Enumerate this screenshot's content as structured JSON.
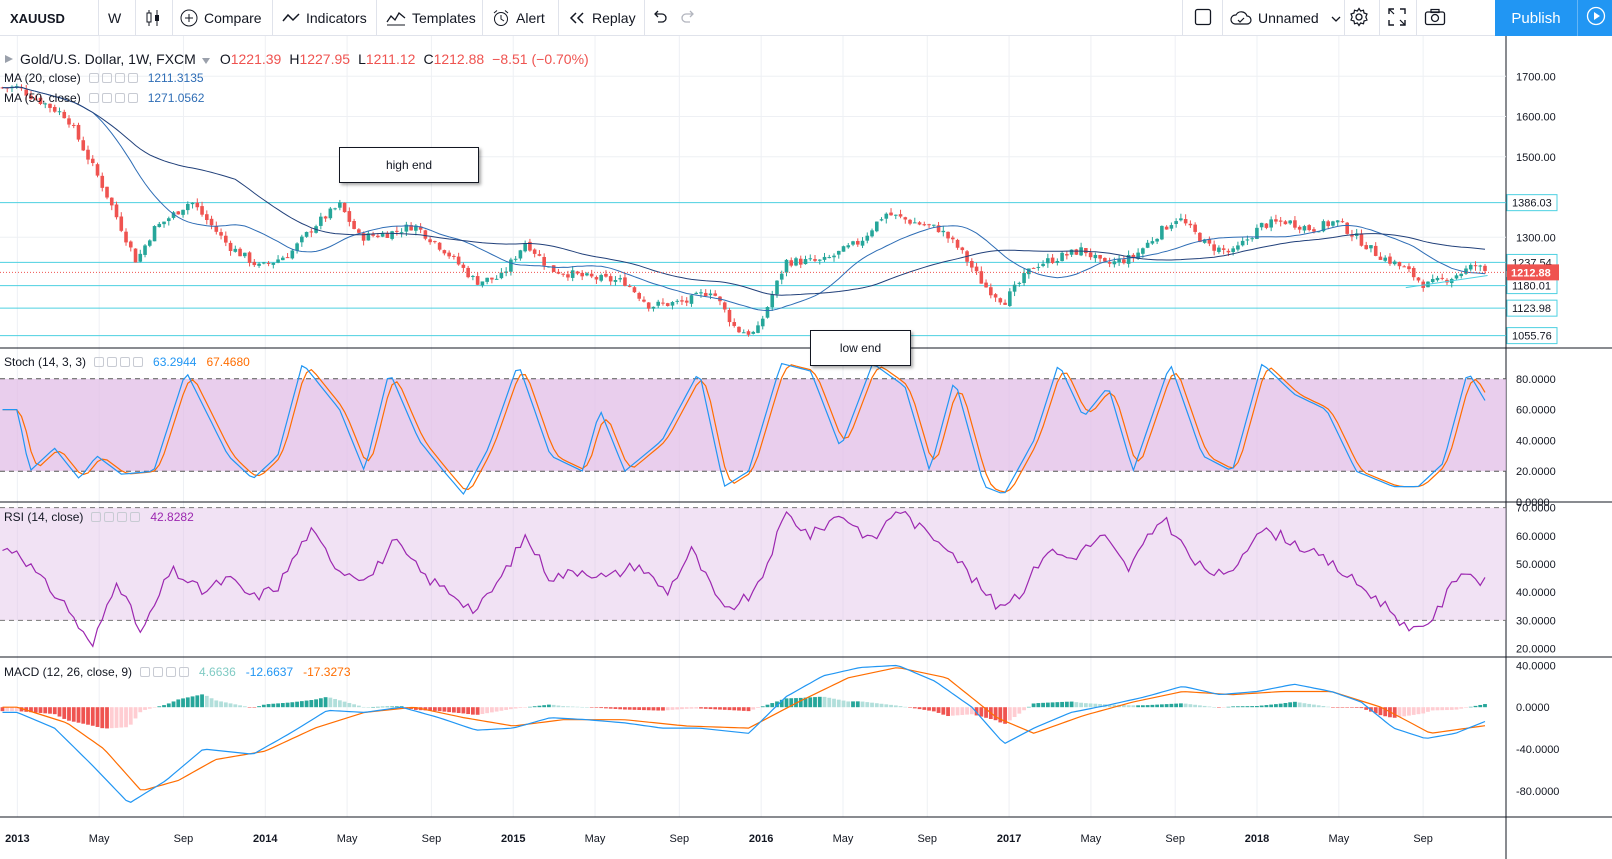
{
  "toolbar": {
    "symbol": "XAUUSD",
    "interval": "W",
    "compare": "Compare",
    "indicators": "Indicators",
    "templates": "Templates",
    "alert": "Alert",
    "replay": "Replay",
    "layout_name": "Unnamed",
    "publish": "Publish"
  },
  "header": {
    "title": "Gold/U.S. Dollar, 1W, FXCM",
    "open_label": "O",
    "open": "1221.39",
    "high_label": "H",
    "high": "1227.95",
    "low_label": "L",
    "low": "1211.12",
    "close_label": "C",
    "close": "1212.88",
    "change": "−8.51 (−0.70%)"
  },
  "indicators": {
    "ma20": {
      "label": "MA (20, close)",
      "value": "1211.3135",
      "color": "#2e6db5"
    },
    "ma50": {
      "label": "MA (50, close)",
      "value": "1271.0562",
      "color": "#21407a"
    },
    "stoch": {
      "label": "Stoch (14, 3, 3)",
      "k": "63.2944",
      "d": "67.4680",
      "k_color": "#2196f3",
      "d_color": "#ff6d00"
    },
    "rsi": {
      "label": "RSI (14, close)",
      "value": "42.8282",
      "color": "#9c27b0"
    },
    "macd": {
      "label": "MACD (12, 26, close, 9)",
      "hist": "4.6636",
      "macd": "-12.6637",
      "signal": "-17.3273"
    }
  },
  "annotations": {
    "high_end": "high end",
    "low_end": "low end"
  },
  "colors": {
    "up": "#26a69a",
    "down": "#ef5350",
    "band": "#e1bee7",
    "hline": "#4dd0e1"
  },
  "chart_data": [
    {
      "type": "candlestick",
      "title": "Gold/U.S. Dollar, 1W, FXCM",
      "x_ticks": [
        "2013",
        "May",
        "Sep",
        "2014",
        "May",
        "Sep",
        "2015",
        "May",
        "Sep",
        "2016",
        "May",
        "Sep",
        "2017",
        "May",
        "Sep",
        "2018",
        "May",
        "Sep"
      ],
      "y_ticks": [
        "1700.00",
        "1600.00",
        "1500.00",
        "1300.00"
      ],
      "ylim": [
        1025,
        1800
      ],
      "price_levels": [
        1386.03,
        1237.54,
        1180.01,
        1123.98,
        1055.76
      ],
      "last_price": 1212.88,
      "close_trend": [
        [
          2013.0,
          1672
        ],
        [
          2013.2,
          1600
        ],
        [
          2013.35,
          1420
        ],
        [
          2013.48,
          1240
        ],
        [
          2013.55,
          1320
        ],
        [
          2013.7,
          1390
        ],
        [
          2013.85,
          1280
        ],
        [
          2013.98,
          1225
        ],
        [
          2014.1,
          1260
        ],
        [
          2014.2,
          1330
        ],
        [
          2014.3,
          1380
        ],
        [
          2014.38,
          1300
        ],
        [
          2014.5,
          1310
        ],
        [
          2014.6,
          1330
        ],
        [
          2014.72,
          1270
        ],
        [
          2014.85,
          1190
        ],
        [
          2014.95,
          1200
        ],
        [
          2015.05,
          1290
        ],
        [
          2015.15,
          1220
        ],
        [
          2015.3,
          1200
        ],
        [
          2015.45,
          1190
        ],
        [
          2015.55,
          1130
        ],
        [
          2015.7,
          1140
        ],
        [
          2015.8,
          1170
        ],
        [
          2015.9,
          1070
        ],
        [
          2015.98,
          1060
        ],
        [
          2016.1,
          1240
        ],
        [
          2016.25,
          1240
        ],
        [
          2016.4,
          1290
        ],
        [
          2016.5,
          1360
        ],
        [
          2016.6,
          1340
        ],
        [
          2016.72,
          1320
        ],
        [
          2016.8,
          1270
        ],
        [
          2016.9,
          1180
        ],
        [
          2016.98,
          1140
        ],
        [
          2017.1,
          1230
        ],
        [
          2017.2,
          1250
        ],
        [
          2017.3,
          1270
        ],
        [
          2017.38,
          1230
        ],
        [
          2017.5,
          1250
        ],
        [
          2017.62,
          1320
        ],
        [
          2017.68,
          1350
        ],
        [
          2017.8,
          1280
        ],
        [
          2017.9,
          1260
        ],
        [
          2018.02,
          1330
        ],
        [
          2018.12,
          1340
        ],
        [
          2018.22,
          1320
        ],
        [
          2018.32,
          1340
        ],
        [
          2018.4,
          1300
        ],
        [
          2018.48,
          1260
        ],
        [
          2018.6,
          1220
        ],
        [
          2018.68,
          1180
        ],
        [
          2018.78,
          1200
        ],
        [
          2018.88,
          1230
        ],
        [
          2018.93,
          1213
        ]
      ]
    },
    {
      "type": "line",
      "title": "Stoch (14, 3, 3)",
      "y_ticks": [
        "80.0000",
        "60.0000",
        "40.0000",
        "20.0000",
        "0.0000"
      ],
      "ylim": [
        0,
        100
      ],
      "band": [
        20,
        80
      ],
      "k_trend": [
        [
          2013.0,
          60
        ],
        [
          2013.05,
          20
        ],
        [
          2013.15,
          35
        ],
        [
          2013.25,
          15
        ],
        [
          2013.32,
          30
        ],
        [
          2013.42,
          18
        ],
        [
          2013.55,
          20
        ],
        [
          2013.68,
          85
        ],
        [
          2013.85,
          30
        ],
        [
          2013.95,
          15
        ],
        [
          2014.05,
          30
        ],
        [
          2014.15,
          90
        ],
        [
          2014.3,
          60
        ],
        [
          2014.4,
          20
        ],
        [
          2014.5,
          85
        ],
        [
          2014.62,
          40
        ],
        [
          2014.72,
          20
        ],
        [
          2014.8,
          5
        ],
        [
          2014.9,
          35
        ],
        [
          2015.02,
          90
        ],
        [
          2015.15,
          30
        ],
        [
          2015.28,
          20
        ],
        [
          2015.35,
          60
        ],
        [
          2015.45,
          20
        ],
        [
          2015.6,
          40
        ],
        [
          2015.75,
          85
        ],
        [
          2015.85,
          10
        ],
        [
          2015.95,
          20
        ],
        [
          2016.08,
          90
        ],
        [
          2016.2,
          85
        ],
        [
          2016.32,
          35
        ],
        [
          2016.45,
          90
        ],
        [
          2016.58,
          75
        ],
        [
          2016.68,
          20
        ],
        [
          2016.78,
          80
        ],
        [
          2016.9,
          10
        ],
        [
          2016.98,
          5
        ],
        [
          2017.1,
          40
        ],
        [
          2017.2,
          90
        ],
        [
          2017.3,
          55
        ],
        [
          2017.4,
          75
        ],
        [
          2017.5,
          20
        ],
        [
          2017.65,
          90
        ],
        [
          2017.78,
          30
        ],
        [
          2017.9,
          20
        ],
        [
          2018.02,
          90
        ],
        [
          2018.15,
          70
        ],
        [
          2018.28,
          60
        ],
        [
          2018.4,
          20
        ],
        [
          2018.55,
          10
        ],
        [
          2018.65,
          10
        ],
        [
          2018.75,
          25
        ],
        [
          2018.85,
          85
        ],
        [
          2018.93,
          63
        ]
      ]
    },
    {
      "type": "line",
      "title": "RSI (14, close)",
      "y_ticks": [
        "70.0000",
        "60.0000",
        "50.0000",
        "40.0000",
        "30.0000",
        "20.0000"
      ],
      "ylim": [
        17,
        72
      ],
      "band": [
        30,
        70
      ],
      "trend": [
        [
          2013.0,
          55
        ],
        [
          2013.1,
          44
        ],
        [
          2013.2,
          35
        ],
        [
          2013.3,
          20
        ],
        [
          2013.4,
          45
        ],
        [
          2013.5,
          25
        ],
        [
          2013.62,
          48
        ],
        [
          2013.75,
          40
        ],
        [
          2013.85,
          45
        ],
        [
          2013.95,
          38
        ],
        [
          2014.05,
          42
        ],
        [
          2014.18,
          62
        ],
        [
          2014.3,
          48
        ],
        [
          2014.42,
          45
        ],
        [
          2014.52,
          58
        ],
        [
          2014.65,
          45
        ],
        [
          2014.75,
          40
        ],
        [
          2014.85,
          33
        ],
        [
          2014.95,
          45
        ],
        [
          2015.05,
          60
        ],
        [
          2015.15,
          45
        ],
        [
          2015.28,
          48
        ],
        [
          2015.38,
          45
        ],
        [
          2015.5,
          50
        ],
        [
          2015.62,
          40
        ],
        [
          2015.72,
          55
        ],
        [
          2015.85,
          33
        ],
        [
          2015.98,
          40
        ],
        [
          2016.1,
          68
        ],
        [
          2016.2,
          60
        ],
        [
          2016.32,
          68
        ],
        [
          2016.45,
          58
        ],
        [
          2016.55,
          70
        ],
        [
          2016.65,
          62
        ],
        [
          2016.75,
          57
        ],
        [
          2016.85,
          45
        ],
        [
          2016.95,
          35
        ],
        [
          2017.05,
          40
        ],
        [
          2017.15,
          55
        ],
        [
          2017.25,
          52
        ],
        [
          2017.38,
          60
        ],
        [
          2017.48,
          48
        ],
        [
          2017.62,
          67
        ],
        [
          2017.75,
          50
        ],
        [
          2017.88,
          45
        ],
        [
          2018.0,
          62
        ],
        [
          2018.1,
          60
        ],
        [
          2018.2,
          55
        ],
        [
          2018.3,
          50
        ],
        [
          2018.45,
          40
        ],
        [
          2018.55,
          33
        ],
        [
          2018.62,
          25
        ],
        [
          2018.72,
          32
        ],
        [
          2018.82,
          48
        ],
        [
          2018.93,
          43
        ]
      ]
    },
    {
      "type": "line",
      "title": "MACD (12, 26, close, 9)",
      "y_ticks": [
        "40.0000",
        "0.0000",
        "-40.0000",
        "-80.0000"
      ],
      "ylim": [
        -105,
        48
      ],
      "macd_trend": [
        [
          2013.0,
          -5
        ],
        [
          2013.15,
          -20
        ],
        [
          2013.3,
          -55
        ],
        [
          2013.45,
          -92
        ],
        [
          2013.6,
          -70
        ],
        [
          2013.75,
          -40
        ],
        [
          2013.95,
          -45
        ],
        [
          2014.1,
          -25
        ],
        [
          2014.25,
          -3
        ],
        [
          2014.4,
          -5
        ],
        [
          2014.55,
          0
        ],
        [
          2014.7,
          -10
        ],
        [
          2014.85,
          -22
        ],
        [
          2015.0,
          -20
        ],
        [
          2015.15,
          -10
        ],
        [
          2015.3,
          -12
        ],
        [
          2015.45,
          -15
        ],
        [
          2015.6,
          -20
        ],
        [
          2015.75,
          -20
        ],
        [
          2015.95,
          -25
        ],
        [
          2016.1,
          10
        ],
        [
          2016.25,
          30
        ],
        [
          2016.4,
          38
        ],
        [
          2016.55,
          40
        ],
        [
          2016.7,
          25
        ],
        [
          2016.85,
          0
        ],
        [
          2016.98,
          -35
        ],
        [
          2017.1,
          -20
        ],
        [
          2017.25,
          -5
        ],
        [
          2017.4,
          2
        ],
        [
          2017.55,
          10
        ],
        [
          2017.7,
          20
        ],
        [
          2017.85,
          12
        ],
        [
          2018.0,
          15
        ],
        [
          2018.15,
          22
        ],
        [
          2018.3,
          15
        ],
        [
          2018.42,
          5
        ],
        [
          2018.55,
          -20
        ],
        [
          2018.68,
          -30
        ],
        [
          2018.8,
          -25
        ],
        [
          2018.93,
          -12.66
        ]
      ],
      "signal_trend": [
        [
          2013.0,
          0
        ],
        [
          2013.2,
          -15
        ],
        [
          2013.35,
          -40
        ],
        [
          2013.5,
          -80
        ],
        [
          2013.65,
          -70
        ],
        [
          2013.8,
          -50
        ],
        [
          2014.0,
          -42
        ],
        [
          2014.2,
          -20
        ],
        [
          2014.4,
          -5
        ],
        [
          2014.6,
          0
        ],
        [
          2014.8,
          -10
        ],
        [
          2015.0,
          -18
        ],
        [
          2015.2,
          -12
        ],
        [
          2015.45,
          -12
        ],
        [
          2015.7,
          -18
        ],
        [
          2015.95,
          -20
        ],
        [
          2016.15,
          5
        ],
        [
          2016.35,
          28
        ],
        [
          2016.55,
          38
        ],
        [
          2016.75,
          28
        ],
        [
          2016.95,
          -10
        ],
        [
          2017.1,
          -25
        ],
        [
          2017.3,
          -8
        ],
        [
          2017.5,
          5
        ],
        [
          2017.7,
          15
        ],
        [
          2017.9,
          12
        ],
        [
          2018.1,
          15
        ],
        [
          2018.3,
          15
        ],
        [
          2018.5,
          0
        ],
        [
          2018.7,
          -25
        ],
        [
          2018.93,
          -17.33
        ]
      ]
    }
  ]
}
